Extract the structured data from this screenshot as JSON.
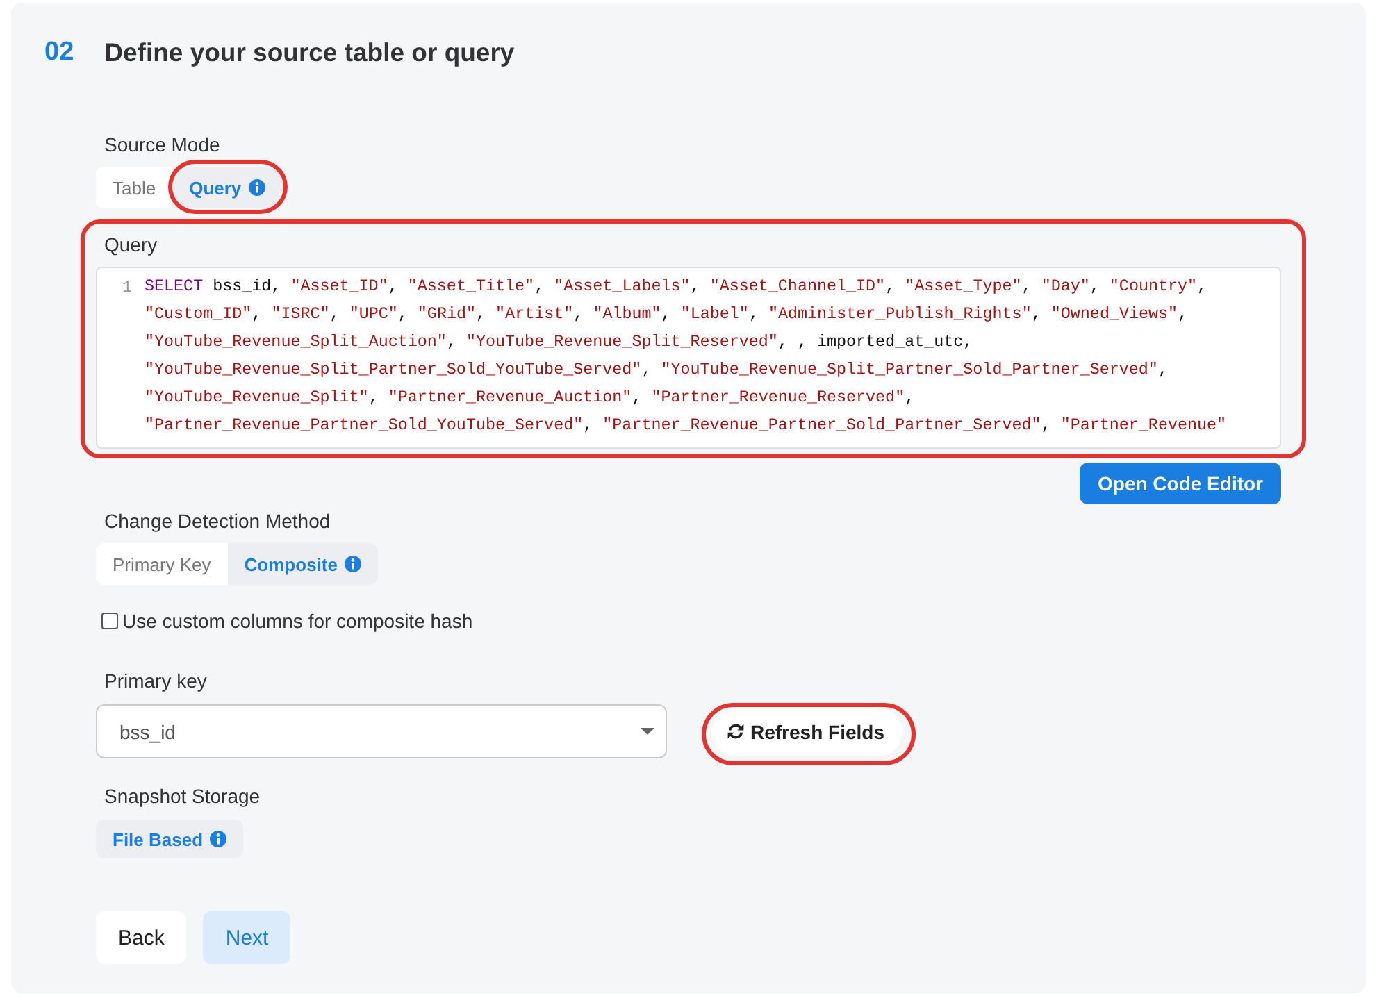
{
  "step": {
    "number": "02",
    "title": "Define your source table or query"
  },
  "source_mode": {
    "label": "Source Mode",
    "options": [
      {
        "label": "Table",
        "selected": false,
        "info": false,
        "highlighted": false
      },
      {
        "label": "Query",
        "selected": true,
        "info": true,
        "highlighted": true
      }
    ]
  },
  "query": {
    "label": "Query",
    "highlighted": true,
    "lines": [
      {
        "number": "1",
        "keyword": "SELECT",
        "text": "bss_id, \"Asset_ID\", \"Asset_Title\", \"Asset_Labels\", \"Asset_Channel_ID\", \"Asset_Type\", \"Day\", \"Country\","
      },
      {
        "text": "\"Custom_ID\", \"ISRC\", \"UPC\", \"GRid\", \"Artist\", \"Album\", \"Label\", \"Administer_Publish_Rights\", \"Owned_Views\","
      },
      {
        "text": "\"YouTube_Revenue_Split_Auction\", \"YouTube_Revenue_Split_Reserved\", , imported_at_utc,"
      },
      {
        "text": "\"YouTube_Revenue_Split_Partner_Sold_YouTube_Served\", \"YouTube_Revenue_Split_Partner_Sold_Partner_Served\","
      },
      {
        "text": "\"YouTube_Revenue_Split\", \"Partner_Revenue_Auction\", \"Partner_Revenue_Reserved\","
      },
      {
        "text": "\"Partner_Revenue_Partner_Sold_YouTube_Served\", \"Partner_Revenue_Partner_Sold_Partner_Served\", \"Partner_Revenue\""
      }
    ]
  },
  "open_code_editor_button": {
    "label": "Open Code Editor"
  },
  "change_detection": {
    "label": "Change Detection Method",
    "options": [
      {
        "label": "Primary Key",
        "selected": false,
        "info": false
      },
      {
        "label": "Composite",
        "selected": true,
        "info": true
      }
    ]
  },
  "composite_hash_checkbox": {
    "label": "Use custom columns for composite hash",
    "checked": false
  },
  "primary_key": {
    "label": "Primary key",
    "value": "bss_id"
  },
  "refresh_button": {
    "label": "Refresh Fields",
    "highlighted": true
  },
  "snapshot_storage": {
    "label": "Snapshot Storage",
    "options": [
      {
        "label": "File Based",
        "selected": true,
        "info": true
      }
    ]
  },
  "buttons": [
    {
      "label": "Back",
      "kind": "back"
    },
    {
      "label": "Next",
      "kind": "next"
    }
  ]
}
